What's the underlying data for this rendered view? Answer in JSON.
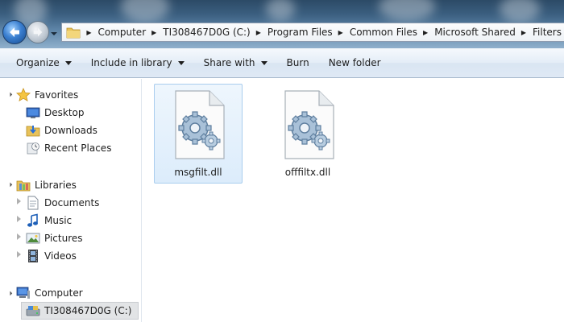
{
  "address_bar": {
    "breadcrumbs": [
      "Computer",
      "TI308467D0G (C:)",
      "Program Files",
      "Common Files",
      "Microsoft Shared",
      "Filters"
    ]
  },
  "toolbar": {
    "organize": "Organize",
    "include_in_library": "Include in library",
    "share_with": "Share with",
    "burn": "Burn",
    "new_folder": "New folder"
  },
  "nav_pane": {
    "favorites_label": "Favorites",
    "favorites": [
      {
        "label": "Desktop",
        "icon": "desktop-icon"
      },
      {
        "label": "Downloads",
        "icon": "downloads-icon"
      },
      {
        "label": "Recent Places",
        "icon": "recent-places-icon"
      }
    ],
    "libraries_label": "Libraries",
    "libraries": [
      {
        "label": "Documents",
        "icon": "documents-icon"
      },
      {
        "label": "Music",
        "icon": "music-icon"
      },
      {
        "label": "Pictures",
        "icon": "pictures-icon"
      },
      {
        "label": "Videos",
        "icon": "videos-icon"
      }
    ],
    "computer_label": "Computer",
    "computer_children": [
      {
        "label": "TI308467D0G (C:)",
        "icon": "drive-icon",
        "selected": true
      }
    ]
  },
  "files": [
    {
      "name": "msgfilt.dll",
      "icon": "dll-gear-icon",
      "selected": true
    },
    {
      "name": "offfiltx.dll",
      "icon": "dll-gear-icon",
      "selected": false
    }
  ],
  "colors": {
    "selection_fill": "#dcecfb",
    "selection_border": "#a9cdee",
    "command_bar": "#dfe9f5"
  }
}
